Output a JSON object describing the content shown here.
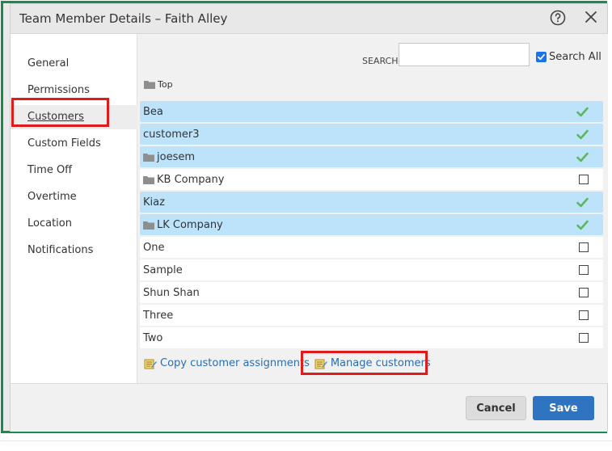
{
  "dialog": {
    "title": "Team Member Details – Faith Alley",
    "help_icon": "help-circle-icon",
    "close_icon": "close-icon"
  },
  "sidebar": {
    "items": [
      {
        "label": "General"
      },
      {
        "label": "Permissions"
      },
      {
        "label": "Customers",
        "active": true
      },
      {
        "label": "Custom Fields"
      },
      {
        "label": "Time Off"
      },
      {
        "label": "Overtime"
      },
      {
        "label": "Location"
      },
      {
        "label": "Notifications"
      }
    ]
  },
  "search": {
    "label": "SEARCH",
    "value": "",
    "placeholder": "",
    "search_all_label": "Search All",
    "search_all_checked": true
  },
  "breadcrumb": {
    "label": "Top"
  },
  "customers": [
    {
      "name": "Bea",
      "folder": false,
      "assigned": true
    },
    {
      "name": "customer3",
      "folder": false,
      "assigned": true
    },
    {
      "name": "joesem",
      "folder": true,
      "assigned": true
    },
    {
      "name": "KB Company",
      "folder": true,
      "assigned": false
    },
    {
      "name": "Kiaz",
      "folder": false,
      "assigned": true
    },
    {
      "name": "LK Company",
      "folder": true,
      "assigned": true
    },
    {
      "name": "One",
      "folder": false,
      "assigned": false
    },
    {
      "name": "Sample",
      "folder": false,
      "assigned": false
    },
    {
      "name": "Shun Shan",
      "folder": false,
      "assigned": false
    },
    {
      "name": "Three",
      "folder": false,
      "assigned": false
    },
    {
      "name": "Two",
      "folder": false,
      "assigned": false
    }
  ],
  "links": {
    "copy_assignments": "Copy customer assignments",
    "manage_customers": "Manage customers"
  },
  "footer": {
    "cancel_label": "Cancel",
    "save_label": "Save"
  },
  "colors": {
    "selected_row": "#bde3fb",
    "checkmark": "#5cb85c",
    "save_button": "#2f74c0",
    "frame": "#1a8a4e",
    "highlight": "#e01b1b"
  }
}
